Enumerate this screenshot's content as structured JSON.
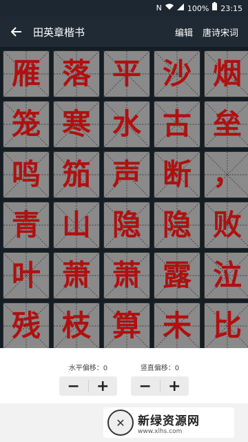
{
  "status_bar": {
    "nfc_icon": "N",
    "battery": "100%",
    "time": "23:15"
  },
  "app_bar": {
    "title": "田英章楷书",
    "edit_label": "编辑",
    "poems_label": "唐诗宋词"
  },
  "grid": {
    "characters": [
      "雁",
      "落",
      "平",
      "沙",
      "烟",
      "笼",
      "寒",
      "水",
      "古",
      "垒",
      "鸣",
      "笳",
      "声",
      "断",
      "，",
      "青",
      "山",
      "隐",
      "隐",
      "败",
      "叶",
      "萧",
      "萧",
      "露",
      "泣",
      "残",
      "枝",
      "算",
      "未",
      "比"
    ]
  },
  "controls": {
    "horizontal": {
      "label": "水平偏移：0",
      "minus": "−",
      "plus": "+"
    },
    "vertical": {
      "label": "竖直偏移：0",
      "minus": "−",
      "plus": "+"
    }
  },
  "watermark": {
    "logo": "✕",
    "name": "新绿资源网",
    "url": "www.xlhs.com"
  }
}
